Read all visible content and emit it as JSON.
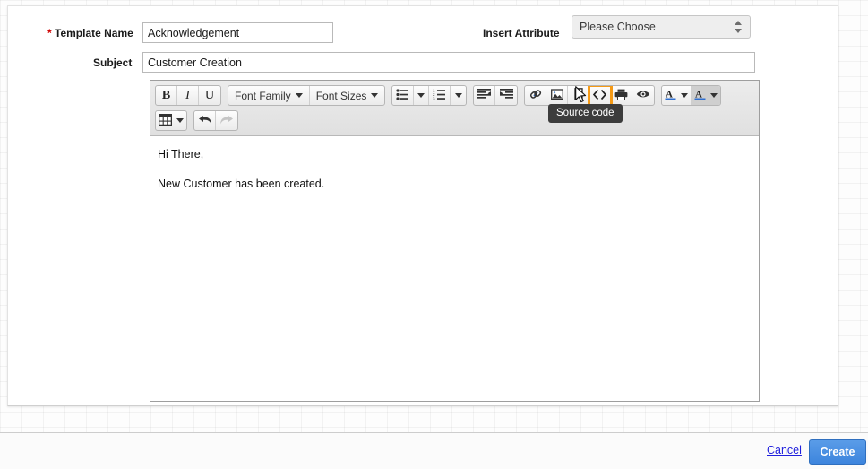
{
  "form": {
    "template_name": {
      "label": "Template Name",
      "required_marker": "*",
      "value": "Acknowledgement",
      "placeholder": ""
    },
    "subject": {
      "label": "Subject",
      "value": "Customer Creation",
      "placeholder": ""
    },
    "insert_attribute": {
      "label": "Insert Attribute",
      "selected": "Please Choose",
      "options": [
        "Please Choose"
      ]
    }
  },
  "editor": {
    "toolbar": {
      "row1": [
        {
          "name": "bold-button",
          "glyph": "B",
          "kind": "text"
        },
        {
          "name": "italic-button",
          "glyph": "I",
          "kind": "text"
        },
        {
          "name": "underline-button",
          "glyph": "U",
          "kind": "text"
        },
        {
          "name": "font-family-button",
          "glyph": "Font Family",
          "kind": "label"
        },
        {
          "name": "font-sizes-button",
          "glyph": "Font Sizes",
          "kind": "label"
        },
        {
          "name": "bullet-list-button",
          "glyph": "bullet-list-icon",
          "kind": "icon"
        },
        {
          "name": "numbered-list-button",
          "glyph": "numbered-list-icon",
          "kind": "icon"
        },
        {
          "name": "outdent-button",
          "glyph": "outdent-icon",
          "kind": "icon"
        },
        {
          "name": "indent-button",
          "glyph": "indent-icon",
          "kind": "icon"
        },
        {
          "name": "insert-link-button",
          "glyph": "link-icon",
          "kind": "icon"
        },
        {
          "name": "insert-image-button",
          "glyph": "image-icon",
          "kind": "icon"
        },
        {
          "name": "anchor-button",
          "glyph": "anchor-icon",
          "kind": "icon"
        },
        {
          "name": "source-code-button",
          "glyph": "source-code-icon",
          "kind": "icon"
        },
        {
          "name": "print-button",
          "glyph": "print-icon",
          "kind": "icon"
        },
        {
          "name": "preview-button",
          "glyph": "preview-eye-icon",
          "kind": "icon"
        },
        {
          "name": "text-color-button",
          "glyph": "A",
          "kind": "text"
        },
        {
          "name": "background-color-button",
          "glyph": "A",
          "kind": "text"
        }
      ],
      "row2": [
        {
          "name": "table-button",
          "glyph": "table-icon",
          "kind": "icon"
        },
        {
          "name": "undo-button",
          "glyph": "undo-icon",
          "kind": "icon"
        },
        {
          "name": "redo-button",
          "glyph": "redo-icon",
          "kind": "icon"
        }
      ],
      "tooltip": "Source code",
      "highlight_color": "#f59a16"
    },
    "body": {
      "line1": "Hi There,",
      "line2": "New Customer has been created."
    }
  },
  "footer": {
    "cancel_label": "Cancel",
    "create_label": "Create",
    "cancel_color": "#2020dd",
    "create_color": "#4a90e2"
  }
}
